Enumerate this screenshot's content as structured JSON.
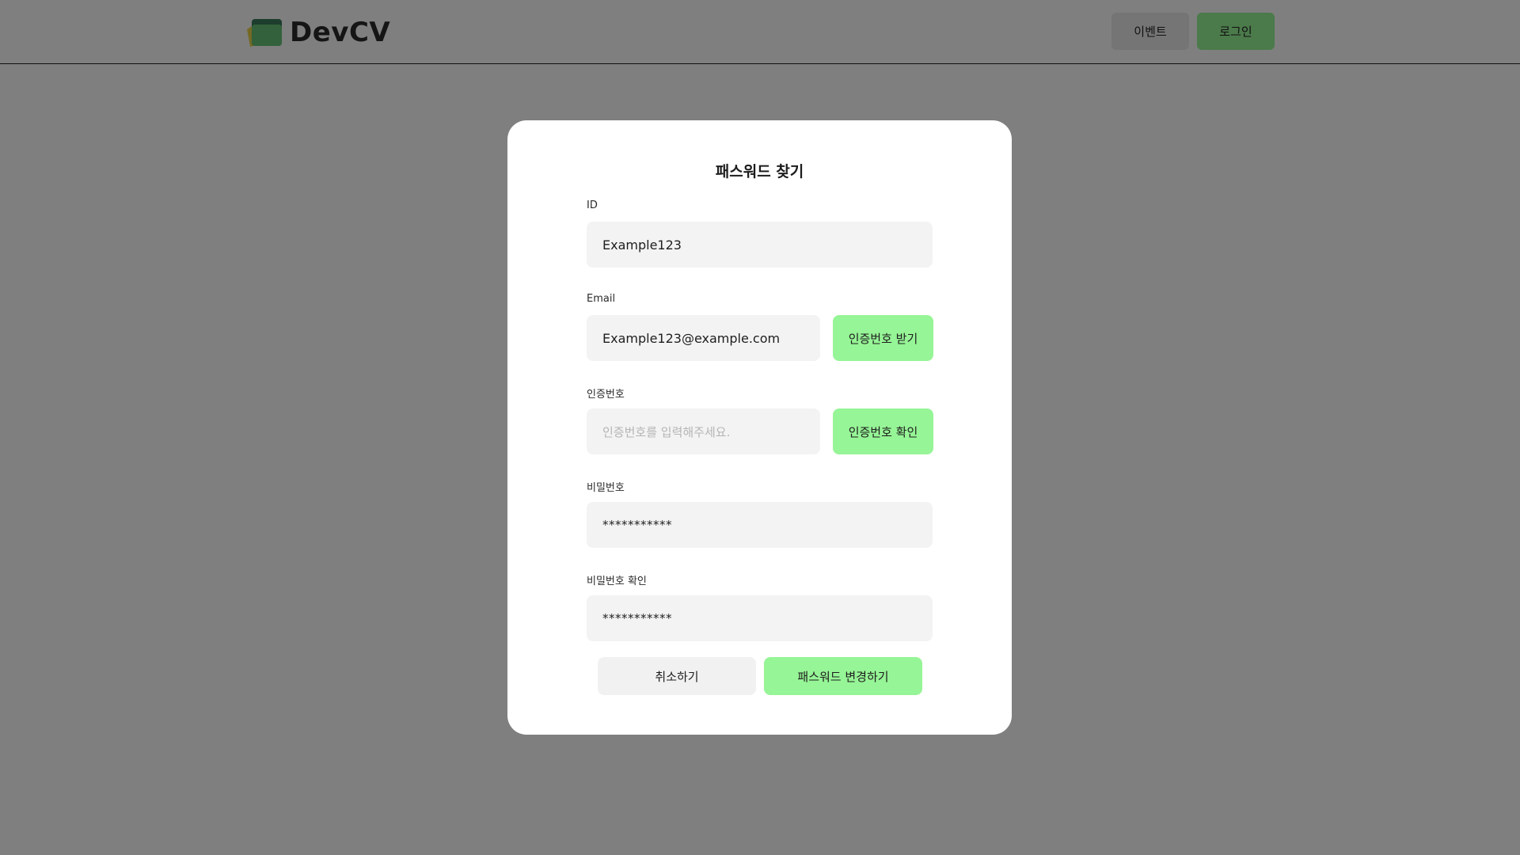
{
  "header": {
    "logo_text": "DevCV",
    "nav": {
      "event_label": "이벤트",
      "login_label": "로그인"
    }
  },
  "modal": {
    "title": "패스워드 찾기",
    "id_field": {
      "label": "ID",
      "value": "Example123"
    },
    "email_field": {
      "label": "Email",
      "value": "Example123@example.com",
      "button_label": "인증번호 받기"
    },
    "code_field": {
      "label": "인증번호",
      "placeholder": "인증번호를 입력해주세요.",
      "button_label": "인증번호 확인"
    },
    "password_field": {
      "label": "비밀번호",
      "value": "***********"
    },
    "password_confirm_field": {
      "label": "비밀번호 확인",
      "value": "***********"
    },
    "cancel_label": "취소하기",
    "submit_label": "패스워드 변경하기"
  },
  "colors": {
    "accent": "#96f596",
    "overlay": "rgba(0,0,0,0.5)",
    "input_bg": "#f3f3f3"
  }
}
